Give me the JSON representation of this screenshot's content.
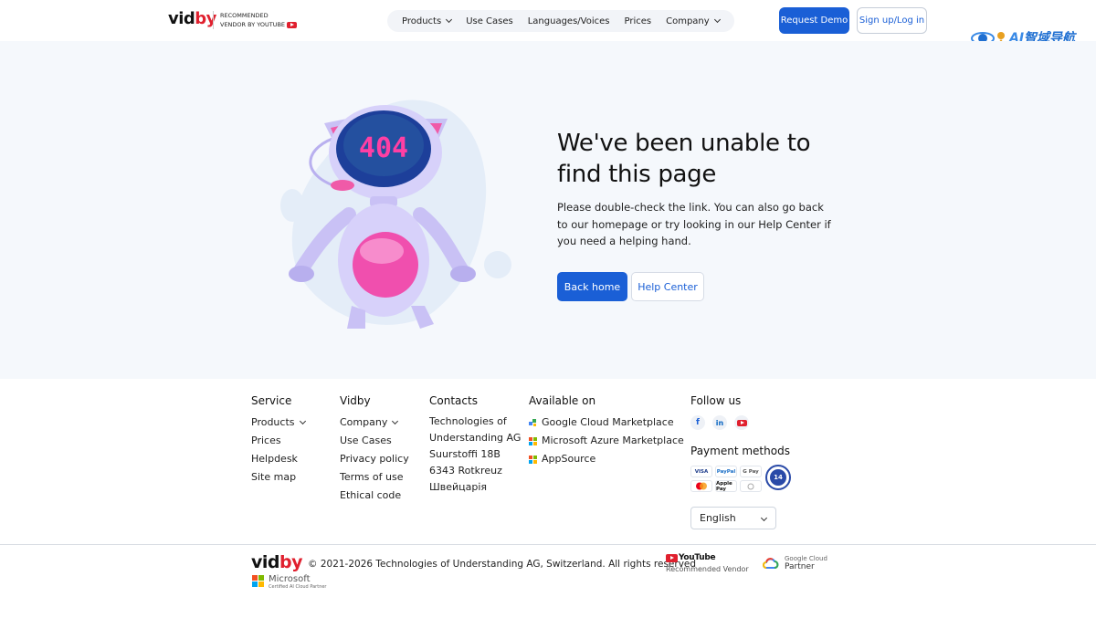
{
  "header": {
    "logo_main": "vid",
    "logo_accent": "by",
    "recommended_line1": "RECOMMENDED",
    "recommended_line2": "VENDOR BY YOUTUBE",
    "nav": [
      {
        "label": "Products",
        "has_dropdown": true
      },
      {
        "label": "Use Cases",
        "has_dropdown": false
      },
      {
        "label": "Languages/Voices",
        "has_dropdown": false
      },
      {
        "label": "Prices",
        "has_dropdown": false
      },
      {
        "label": "Company",
        "has_dropdown": true
      }
    ],
    "request_demo": "Request Demo",
    "sign_up": "Sign up/Log in"
  },
  "watermark": {
    "prefix": "AI",
    "text": "智域导航"
  },
  "hero": {
    "illustration": "robot-404",
    "error_code": "404",
    "title": "We've been unable to find this page",
    "description": "Please double-check the link. You can also go back to our homepage or try looking in our Help Center if you need a helping hand.",
    "back_home": "Back home",
    "help_center": "Help Center"
  },
  "footer": {
    "service": {
      "heading": "Service",
      "links": [
        "Products",
        "Prices",
        "Helpdesk",
        "Site map"
      ]
    },
    "vidby": {
      "heading": "Vidby",
      "links": [
        "Company",
        "Use Cases",
        "Privacy policy",
        "Terms of use",
        "Ethical code"
      ]
    },
    "contacts": {
      "heading": "Contacts",
      "lines": [
        "Technologies of",
        "Understanding AG",
        "Suurstoffi 18B",
        "6343 Rotkreuz",
        "Швейцарія"
      ]
    },
    "available": {
      "heading": "Available on",
      "items": [
        "Google Cloud Marketplace",
        "Microsoft Azure Marketplace",
        "AppSource"
      ]
    },
    "follow": {
      "heading": "Follow us",
      "icons": [
        "facebook-icon",
        "linkedin-icon",
        "youtube-icon"
      ]
    },
    "payment": {
      "heading": "Payment methods",
      "methods": [
        "VISA",
        "PayPal",
        "G Pay",
        "mastercard",
        "Apple Pay",
        "other"
      ],
      "badge_number": "14"
    },
    "language": "English",
    "bottom": {
      "logo_main": "vid",
      "logo_accent": "by",
      "copyright": "© 2021-2026 Technologies of Understanding AG, Switzerland.  All rights reserved",
      "ms_partner_name": "Microsoft",
      "ms_partner_sub": "Certified AI Cloud Partner",
      "youtube_logo": "YouTube",
      "youtube_sub": "Recommended Vendor",
      "gcp_line1": "Google Cloud",
      "gcp_line2": "Partner"
    }
  },
  "colors": {
    "primary": "#1a5fd6",
    "brand_red": "#e0202e",
    "hero_bg": "#f5f8fc"
  }
}
